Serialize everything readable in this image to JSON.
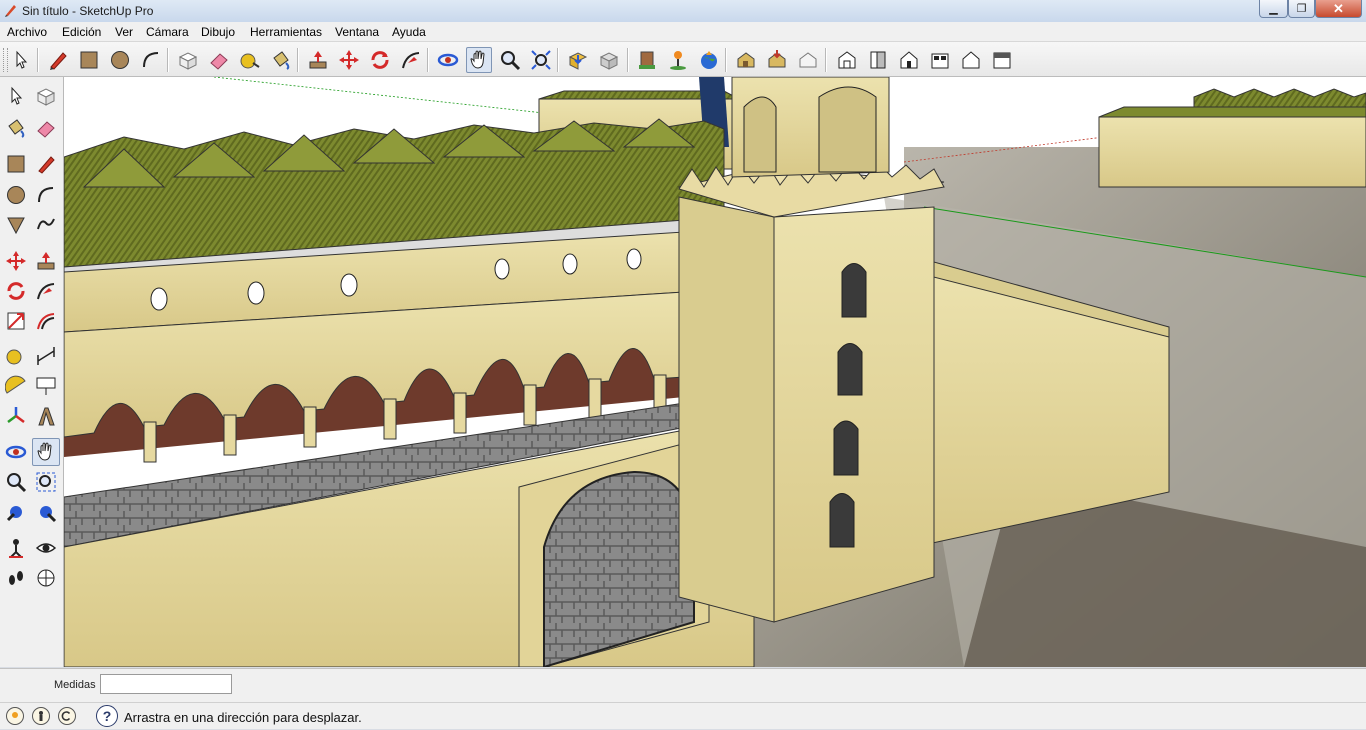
{
  "window": {
    "title": "Sin título - SketchUp Pro",
    "minimize_glyph": "▁",
    "maximize_glyph": "❐",
    "close_glyph": "✕"
  },
  "menu": [
    "Archivo",
    "Edición",
    "Ver",
    "Cámara",
    "Dibujo",
    "Herramientas",
    "Ventana",
    "Ayuda"
  ],
  "toolbar_icons": [
    "select-arrow",
    "pencil-line",
    "rectangle",
    "circle",
    "arc",
    "make-component",
    "eraser",
    "tape-measure",
    "paint-bucket",
    "push-pull",
    "move",
    "rotate",
    "follow-me",
    "orbit",
    "pan",
    "zoom",
    "zoom-extents",
    "get-models",
    "share-model",
    "warehouse-component",
    "add-location",
    "toggle-terrain",
    "google-earth",
    "iso-view",
    "top-view",
    "front-view",
    "right-view",
    "back-view",
    "left-view"
  ],
  "sidebar_icons": [
    "select",
    "make-component",
    "paint-bucket",
    "eraser",
    "rectangle",
    "line",
    "circle",
    "arc",
    "polygon",
    "freehand",
    "move",
    "push-pull",
    "rotate",
    "follow-me",
    "scale",
    "offset",
    "tape-measure",
    "dimension",
    "protractor",
    "text",
    "axes",
    "3d-text",
    "orbit",
    "pan",
    "zoom",
    "zoom-window",
    "previous-view",
    "zoom-extents",
    "position-camera",
    "look-around",
    "walk",
    "section-plane"
  ],
  "measurements": {
    "label": "Medidas",
    "value": ""
  },
  "status": {
    "message": "Arrastra en una dirección para desplazar.",
    "help_glyph": "?"
  },
  "colors": {
    "wall": "#e6d9a0",
    "roof": "#7d8a2f",
    "pavement": "#8a8a8a",
    "arcade_floor": "#6e3a2c",
    "ground": "#aaa498",
    "sky": "#ffffff"
  }
}
